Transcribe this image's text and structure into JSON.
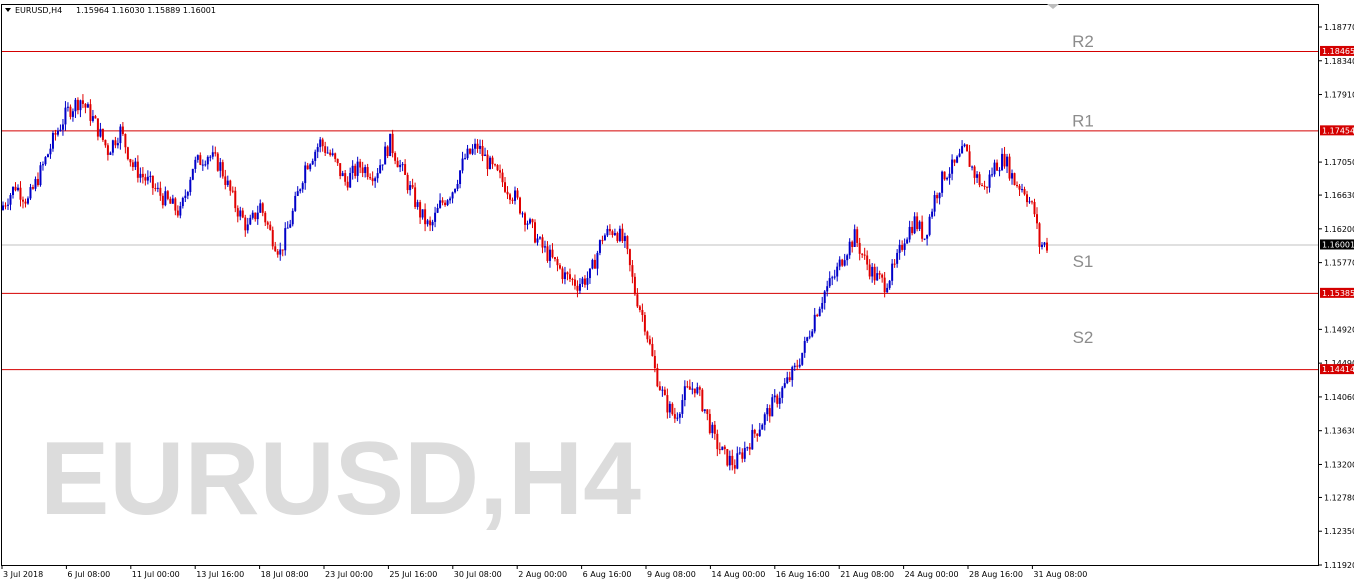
{
  "header": {
    "symbol": "EURUSD,H4",
    "ohlc": "1.15964 1.16030 1.15889 1.16001"
  },
  "watermark": "EURUSD,H4",
  "colors": {
    "bull": "#0000c8",
    "bear": "#e00000",
    "level_line": "#d40000",
    "current_line": "#c0c0c0",
    "current_tag_bg": "#000000",
    "level_tag_bg": "#d40000"
  },
  "chart_data": {
    "type": "candlestick",
    "title": "EURUSD,H4",
    "ylim": [
      1.1192,
      1.1905
    ],
    "y_ticks": [
      "1.18770",
      "1.18340",
      "1.17910",
      "1.17050",
      "1.16630",
      "1.16200",
      "1.15770",
      "1.14920",
      "1.14490",
      "1.14060",
      "1.13630",
      "1.13200",
      "1.12780",
      "1.12350",
      "1.11920"
    ],
    "x_ticks": [
      "3 Jul 2018",
      "6 Jul 08:00",
      "11 Jul 00:00",
      "13 Jul 16:00",
      "18 Jul 08:00",
      "23 Jul 00:00",
      "25 Jul 16:00",
      "30 Jul 08:00",
      "2 Aug 00:00",
      "6 Aug 16:00",
      "9 Aug 08:00",
      "14 Aug 00:00",
      "16 Aug 16:00",
      "21 Aug 08:00",
      "24 Aug 00:00",
      "28 Aug 16:00",
      "31 Aug 08:00"
    ],
    "levels": [
      {
        "name": "R2",
        "price": 1.18465,
        "tag": "1.18465"
      },
      {
        "name": "R1",
        "price": 1.17454,
        "tag": "1.17454"
      },
      {
        "name": "S1",
        "price": 1.15385,
        "tag": "1.15385"
      },
      {
        "name": "S2",
        "price": 1.14414,
        "tag": "1.14414"
      }
    ],
    "current": {
      "price": 1.16001,
      "tag": "1.16001"
    },
    "close_path": [
      [
        0,
        1.165
      ],
      [
        5,
        1.1675
      ],
      [
        10,
        1.1655
      ],
      [
        16,
        1.17
      ],
      [
        21,
        1.174
      ],
      [
        26,
        1.177
      ],
      [
        31,
        1.1785
      ],
      [
        36,
        1.176
      ],
      [
        42,
        1.172
      ],
      [
        47,
        1.1745
      ],
      [
        52,
        1.17
      ],
      [
        58,
        1.168
      ],
      [
        64,
        1.166
      ],
      [
        71,
        1.164
      ],
      [
        76,
        1.17
      ],
      [
        82,
        1.1715
      ],
      [
        87,
        1.17
      ],
      [
        93,
        1.165
      ],
      [
        98,
        1.162
      ],
      [
        103,
        1.165
      ],
      [
        107,
        1.1615
      ],
      [
        111,
        1.159
      ],
      [
        116,
        1.164
      ],
      [
        121,
        1.17
      ],
      [
        127,
        1.173
      ],
      [
        132,
        1.171
      ],
      [
        137,
        1.168
      ],
      [
        143,
        1.17
      ],
      [
        149,
        1.169
      ],
      [
        155,
        1.173
      ],
      [
        159,
        1.17
      ],
      [
        163,
        1.167
      ],
      [
        167,
        1.164
      ],
      [
        171,
        1.162
      ],
      [
        175,
        1.165
      ],
      [
        180,
        1.167
      ],
      [
        185,
        1.171
      ],
      [
        190,
        1.1725
      ],
      [
        195,
        1.17
      ],
      [
        200,
        1.168
      ],
      [
        205,
        1.166
      ],
      [
        210,
        1.163
      ],
      [
        215,
        1.16
      ],
      [
        220,
        1.158
      ],
      [
        225,
        1.156
      ],
      [
        230,
        1.155
      ],
      [
        235,
        1.156
      ],
      [
        240,
        1.161
      ],
      [
        245,
        1.162
      ],
      [
        249,
        1.16
      ],
      [
        253,
        1.154
      ],
      [
        257,
        1.15
      ],
      [
        261,
        1.144
      ],
      [
        265,
        1.14
      ],
      [
        269,
        1.138
      ],
      [
        273,
        1.141
      ],
      [
        277,
        1.142
      ],
      [
        281,
        1.139
      ],
      [
        285,
        1.135
      ],
      [
        289,
        1.133
      ],
      [
        293,
        1.132
      ],
      [
        297,
        1.134
      ],
      [
        301,
        1.136
      ],
      [
        305,
        1.138
      ],
      [
        309,
        1.14
      ],
      [
        313,
        1.142
      ],
      [
        317,
        1.144
      ],
      [
        321,
        1.147
      ],
      [
        325,
        1.151
      ],
      [
        329,
        1.154
      ],
      [
        333,
        1.156
      ],
      [
        337,
        1.159
      ],
      [
        341,
        1.161
      ],
      [
        345,
        1.158
      ],
      [
        349,
        1.156
      ],
      [
        353,
        1.155
      ],
      [
        357,
        1.157
      ],
      [
        361,
        1.161
      ],
      [
        365,
        1.163
      ],
      [
        369,
        1.161
      ],
      [
        373,
        1.166
      ],
      [
        377,
        1.169
      ],
      [
        381,
        1.17
      ],
      [
        385,
        1.172
      ],
      [
        389,
        1.169
      ],
      [
        393,
        1.167
      ],
      [
        397,
        1.17
      ],
      [
        401,
        1.171
      ],
      [
        405,
        1.168
      ],
      [
        409,
        1.167
      ],
      [
        413,
        1.164
      ],
      [
        415,
        1.16
      ],
      [
        418,
        1.16
      ]
    ]
  }
}
